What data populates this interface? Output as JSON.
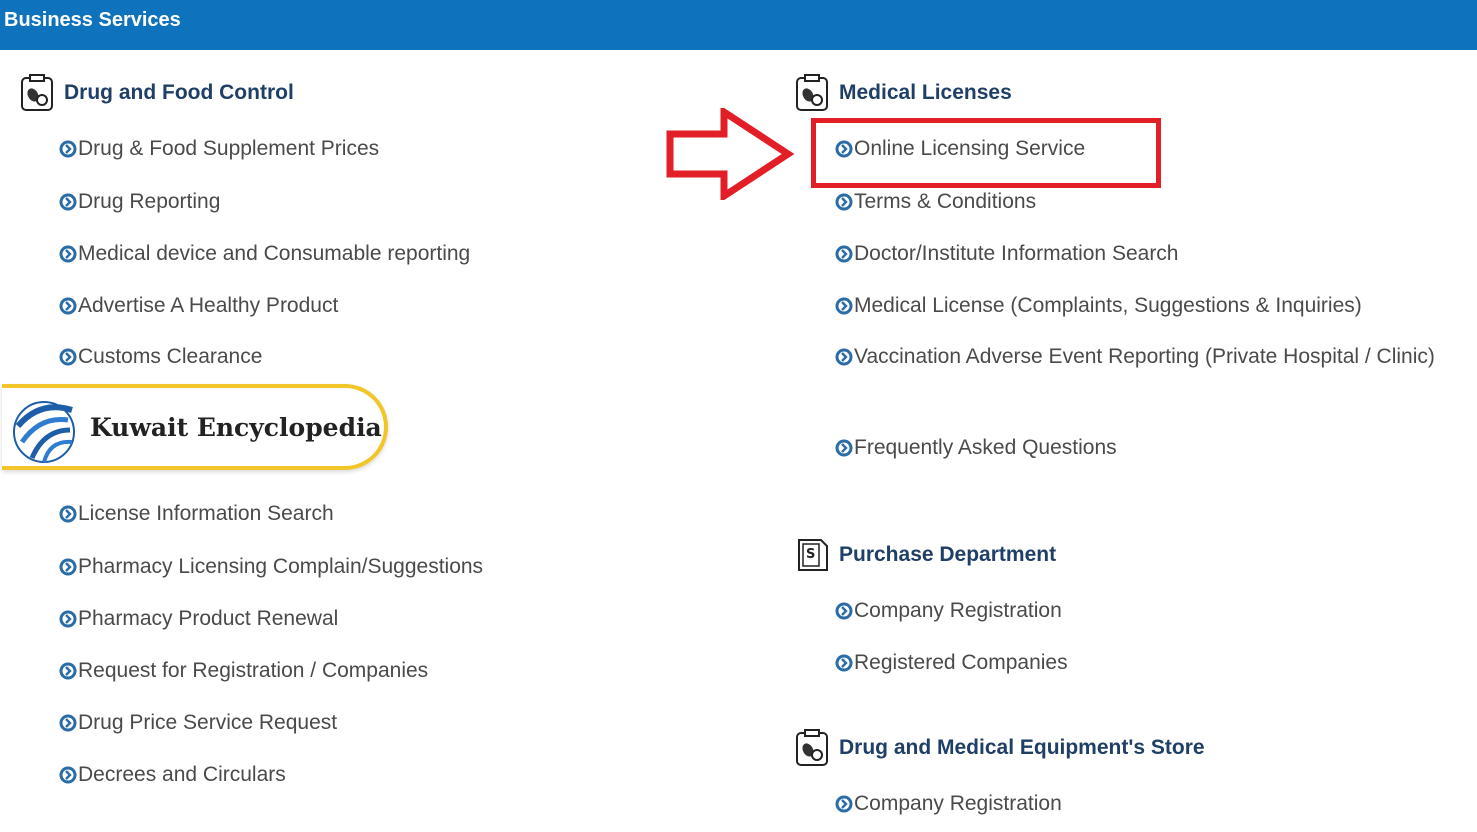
{
  "header": {
    "title": "Business Services"
  },
  "left_section": {
    "title": "Drug and Food Control",
    "icon": "medicine-bottle-icon",
    "items_top": [
      "Drug & Food Supplement Prices",
      "Drug Reporting",
      "Medical device and Consumable reporting",
      "Advertise A Healthy Product",
      "Customs Clearance"
    ],
    "items_bottom": [
      "License Information Search",
      "Pharmacy Licensing Complain/Suggestions",
      "Pharmacy Product Renewal",
      "Request for Registration / Companies",
      "Drug Price Service Request",
      "Decrees and Circulars"
    ]
  },
  "medical_licenses": {
    "title": "Medical Licenses",
    "icon": "medicine-bottle-icon",
    "items": [
      "Online Licensing Service",
      "Terms & Conditions",
      "Doctor/Institute Information Search",
      "Medical License (Complaints, Suggestions & Inquiries)",
      "Vaccination Adverse Event Reporting (Private Hospital / Clinic)",
      "Frequently Asked Questions"
    ]
  },
  "purchase_department": {
    "title": "Purchase Department",
    "icon": "dollar-document-icon",
    "items": [
      "Company Registration",
      "Registered Companies"
    ]
  },
  "equipment_store": {
    "title": "Drug and Medical Equipment's Store",
    "icon": "medicine-bottle-icon",
    "items": [
      "Company Registration"
    ]
  },
  "overlay": {
    "badge_text": "Kuwait Encyclopedia",
    "badge_icon": "globe-swoosh-icon"
  },
  "colors": {
    "header_bg": "#0e72bd",
    "highlight": "#e21e26",
    "badge_border": "#f2c628",
    "section_title": "#1f3f66"
  }
}
